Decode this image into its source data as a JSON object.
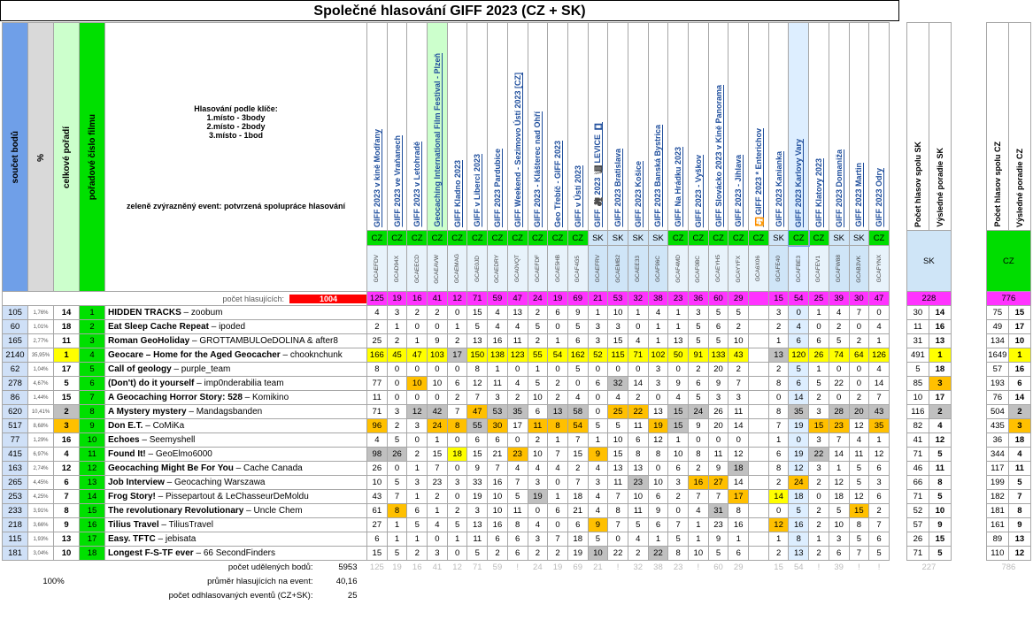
{
  "title": "Společné hlasování GIFF 2023 (CZ + SK)",
  "left_headers": {
    "sum": "součet bodů",
    "pct": "%",
    "overall": "celkové pořadí",
    "order": "pořadové číslo filmu"
  },
  "legend": {
    "line1": "Hlasování podle klíče:",
    "line2": "1.místo - 3body",
    "line3": "2.místo - 2body",
    "line4": "3.místo - 1bod",
    "note": "zeleně zvýrazněný event: potvrzená spolupráce hlasování"
  },
  "voters_label": "počet hlasujících:",
  "voters_total": "1004",
  "events": [
    {
      "name": "GIFF 2023 v kině Modřany",
      "cc": "CZ",
      "code": "GCAEFDV",
      "voters": "125"
    },
    {
      "name": "GIFF 2023 ve Vraňanech",
      "cc": "CZ",
      "code": "GCAD94X",
      "voters": "19"
    },
    {
      "name": "GIFF 2023 v Letohradě",
      "cc": "CZ",
      "code": "GCAEECD",
      "voters": "16"
    },
    {
      "name": "Geocaching International Film Festival - Plzeň",
      "cc": "CZ",
      "code": "GCAEAVW",
      "voters": "41"
    },
    {
      "name": "GIFF Kladno 2023",
      "cc": "CZ",
      "code": "GCAEMAG",
      "voters": "12"
    },
    {
      "name": "GIFF v Liberci 2023",
      "cc": "CZ",
      "code": "GCAE0JD",
      "voters": "71"
    },
    {
      "name": "GIFF 2023 Pardubice",
      "cc": "CZ",
      "code": "GCAEDRY",
      "voters": "59"
    },
    {
      "name": "GIFF Weekend - Sezimovo Ústí 2023 [CZ]",
      "cc": "CZ",
      "code": "GCA0VQT",
      "voters": "47"
    },
    {
      "name": "GIFF 2023 - Klášterec nad Ohří",
      "cc": "CZ",
      "code": "GCAEFDF",
      "voters": "24"
    },
    {
      "name": "Geo Třebíč - GIFF 2023",
      "cc": "CZ",
      "code": "GCAE5HB",
      "voters": "19"
    },
    {
      "name": "GIFF v Ústí 2023",
      "cc": "CZ",
      "code": "GCAF4G5",
      "voters": "69"
    },
    {
      "name": "GIFF 🎥 2023 🎬 LEVICE 🎞",
      "cc": "SK",
      "code": "GCAEFRV",
      "voters": "21"
    },
    {
      "name": "GIFF 2023 Bratislava",
      "cc": "SK",
      "code": "GCAEMB2",
      "voters": "53"
    },
    {
      "name": "GIFF 2023 Košice",
      "cc": "SK",
      "code": "GCAEE33",
      "voters": "32"
    },
    {
      "name": "GIFF 2023 Banská Bystrica",
      "cc": "SK",
      "code": "GCAF96C",
      "voters": "38"
    },
    {
      "name": "GIFF Na Hrádku 2023",
      "cc": "CZ",
      "code": "GCAF4MD",
      "voters": "23"
    },
    {
      "name": "GIFF 2023 - Vyškov",
      "cc": "CZ",
      "code": "GCAF0BC",
      "voters": "36"
    },
    {
      "name": "GIFF Slovácko 2023 v Kině Panorama",
      "cc": "CZ",
      "code": "GCAEYH5",
      "voters": "60"
    },
    {
      "name": "GIFF 2023 - Jihlava",
      "cc": "CZ",
      "code": "GCAYYFX",
      "voters": "29"
    },
    {
      "name": "🎦 GIFF 2023 * Enterichov",
      "cc": "CZ",
      "code": "GCA6X06",
      "voters": ""
    },
    {
      "name": "GIFF 2023 Kanianka",
      "cc": "SK",
      "code": "GCAFE40",
      "voters": "15"
    },
    {
      "name": "GIFF 2023 Karlovy Vary",
      "cc": "CZ",
      "code": "GCAFBE3",
      "voters": "54"
    },
    {
      "name": "GIFF Klatovy 2023",
      "cc": "CZ",
      "code": "GCAFEV1",
      "voters": "25"
    },
    {
      "name": "GIFF 2023 Domaniža",
      "cc": "SK",
      "code": "GCAFW88",
      "voters": "39"
    },
    {
      "name": "GIFF 2023 Martin",
      "cc": "SK",
      "code": "GCAB3VK",
      "voters": "30"
    },
    {
      "name": "GIFF 2023 Odry",
      "cc": "CZ",
      "code": "GCAFYNX",
      "voters": "47"
    }
  ],
  "sk_block": {
    "h1": "Počet hlasov spolu SK",
    "h2": "Výsledné poradie SK",
    "label": "SK",
    "voters": "228"
  },
  "cz_block": {
    "h1": "Počet hlasov spolu CZ",
    "h2": "Výsledné poradie CZ",
    "label": "CZ",
    "voters": "776"
  },
  "films": [
    {
      "sum": "105",
      "pct": "1,76%",
      "rank": "14",
      "order": "1",
      "title": "HIDDEN TRACKS",
      "author": "zoobum",
      "votes": [
        "4",
        "3",
        "2",
        "2",
        "0",
        "15",
        "4",
        "13",
        "2",
        "6",
        "9",
        "1",
        "10",
        "1",
        "4",
        "1",
        "3",
        "5",
        "5",
        "",
        "3",
        "0",
        "1",
        "4",
        "7",
        "0"
      ],
      "sk": "30",
      "skr": "14",
      "cz": "75",
      "czr": "15"
    },
    {
      "sum": "60",
      "pct": "1,01%",
      "rank": "18",
      "order": "2",
      "title": "Eat Sleep Cache Repeat",
      "author": "ipoded",
      "votes": [
        "2",
        "1",
        "0",
        "0",
        "1",
        "5",
        "4",
        "4",
        "5",
        "0",
        "5",
        "3",
        "3",
        "0",
        "1",
        "1",
        "5",
        "6",
        "2",
        "",
        "2",
        "4",
        "0",
        "2",
        "0",
        "4"
      ],
      "sk": "11",
      "skr": "16",
      "cz": "49",
      "czr": "17"
    },
    {
      "sum": "165",
      "pct": "2,77%",
      "rank": "11",
      "order": "3",
      "title": "Roman GeoHoliday",
      "author": "GROTTAMBULOeDOLINA & after8",
      "votes": [
        "25",
        "2",
        "1",
        "9",
        "2",
        "13",
        "16",
        "11",
        "2",
        "1",
        "6",
        "3",
        "15",
        "4",
        "1",
        "13",
        "5",
        "5",
        "10",
        "",
        "1",
        "6",
        "6",
        "5",
        "2",
        "1"
      ],
      "sk": "31",
      "skr": "13",
      "cz": "134",
      "czr": "10"
    },
    {
      "sum": "2140",
      "pct": "35,95%",
      "rank": "1",
      "order": "4",
      "title": "Geocare – Home for the Aged Geocacher",
      "author": "chooknchunk",
      "votes": [
        "166",
        "45",
        "47",
        "103",
        "17",
        "150",
        "138",
        "123",
        "55",
        "54",
        "162",
        "52",
        "115",
        "71",
        "102",
        "50",
        "91",
        "133",
        "43",
        "",
        "13",
        "120",
        "26",
        "74",
        "64",
        "126"
      ],
      "sk": "491",
      "skr": "1",
      "cz": "1649",
      "czr": "1"
    },
    {
      "sum": "62",
      "pct": "1,04%",
      "rank": "17",
      "order": "5",
      "title": "Call of geology",
      "author": "purple_team",
      "votes": [
        "8",
        "0",
        "0",
        "0",
        "0",
        "8",
        "1",
        "0",
        "1",
        "0",
        "5",
        "0",
        "0",
        "0",
        "3",
        "0",
        "2",
        "20",
        "2",
        "",
        "2",
        "5",
        "1",
        "0",
        "0",
        "4"
      ],
      "sk": "5",
      "skr": "18",
      "cz": "57",
      "czr": "16"
    },
    {
      "sum": "278",
      "pct": "4,67%",
      "rank": "5",
      "order": "6",
      "title": "(Don't) do it yourself",
      "author": "imp0nderabilia team",
      "votes": [
        "77",
        "0",
        "10",
        "10",
        "6",
        "12",
        "11",
        "4",
        "5",
        "2",
        "0",
        "6",
        "32",
        "14",
        "3",
        "9",
        "6",
        "9",
        "7",
        "",
        "8",
        "6",
        "5",
        "22",
        "0",
        "14"
      ],
      "sk": "85",
      "skr": "3",
      "cz": "193",
      "czr": "6"
    },
    {
      "sum": "86",
      "pct": "1,44%",
      "rank": "15",
      "order": "7",
      "title": "A Geocaching Horror Story: 528",
      "author": "Komikino",
      "votes": [
        "11",
        "0",
        "0",
        "0",
        "2",
        "7",
        "3",
        "2",
        "10",
        "2",
        "4",
        "0",
        "4",
        "2",
        "0",
        "4",
        "5",
        "3",
        "3",
        "",
        "0",
        "14",
        "2",
        "0",
        "2",
        "7"
      ],
      "sk": "10",
      "skr": "17",
      "cz": "76",
      "czr": "14"
    },
    {
      "sum": "620",
      "pct": "10,41%",
      "rank": "2",
      "order": "8",
      "title": "A Mystery mystery",
      "author": "Mandagsbanden",
      "votes": [
        "71",
        "3",
        "12",
        "42",
        "7",
        "47",
        "53",
        "35",
        "6",
        "13",
        "58",
        "0",
        "25",
        "22",
        "13",
        "15",
        "24",
        "26",
        "11",
        "",
        "8",
        "35",
        "3",
        "28",
        "20",
        "43"
      ],
      "sk": "116",
      "skr": "2",
      "cz": "504",
      "czr": "2"
    },
    {
      "sum": "517",
      "pct": "8,68%",
      "rank": "3",
      "order": "9",
      "title": "Don E.T.",
      "author": "CoMiKa",
      "votes": [
        "96",
        "2",
        "3",
        "24",
        "8",
        "55",
        "30",
        "17",
        "11",
        "8",
        "54",
        "5",
        "5",
        "11",
        "19",
        "15",
        "9",
        "20",
        "14",
        "",
        "7",
        "19",
        "15",
        "23",
        "12",
        "35"
      ],
      "sk": "82",
      "skr": "4",
      "cz": "435",
      "czr": "3"
    },
    {
      "sum": "77",
      "pct": "1,29%",
      "rank": "16",
      "order": "10",
      "title": "Echoes",
      "author": "Seemyshell",
      "votes": [
        "4",
        "5",
        "0",
        "1",
        "0",
        "6",
        "6",
        "0",
        "2",
        "1",
        "7",
        "1",
        "10",
        "6",
        "12",
        "1",
        "0",
        "0",
        "0",
        "",
        "1",
        "0",
        "3",
        "7",
        "4",
        "1"
      ],
      "sk": "41",
      "skr": "12",
      "cz": "36",
      "czr": "18"
    },
    {
      "sum": "415",
      "pct": "6,97%",
      "rank": "4",
      "order": "11",
      "title": "Found It!",
      "author": "GeoElmo6000",
      "votes": [
        "98",
        "26",
        "2",
        "15",
        "18",
        "15",
        "21",
        "23",
        "10",
        "7",
        "15",
        "9",
        "15",
        "8",
        "8",
        "10",
        "8",
        "11",
        "12",
        "",
        "6",
        "19",
        "22",
        "14",
        "11",
        "12"
      ],
      "sk": "71",
      "skr": "5",
      "cz": "344",
      "czr": "4"
    },
    {
      "sum": "163",
      "pct": "2,74%",
      "rank": "12",
      "order": "12",
      "title": "Geocaching Might Be For You",
      "author": "Cache Canada",
      "votes": [
        "26",
        "0",
        "1",
        "7",
        "0",
        "9",
        "7",
        "4",
        "4",
        "4",
        "2",
        "4",
        "13",
        "13",
        "0",
        "6",
        "2",
        "9",
        "18",
        "",
        "8",
        "12",
        "3",
        "1",
        "5",
        "6"
      ],
      "sk": "46",
      "skr": "11",
      "cz": "117",
      "czr": "11"
    },
    {
      "sum": "265",
      "pct": "4,45%",
      "rank": "6",
      "order": "13",
      "title": "Job Interview",
      "author": "Geocaching Warszawa",
      "votes": [
        "10",
        "5",
        "3",
        "23",
        "3",
        "33",
        "16",
        "7",
        "3",
        "0",
        "7",
        "3",
        "11",
        "23",
        "10",
        "3",
        "16",
        "27",
        "14",
        "",
        "2",
        "24",
        "2",
        "12",
        "5",
        "3"
      ],
      "sk": "66",
      "skr": "8",
      "cz": "199",
      "czr": "5"
    },
    {
      "sum": "253",
      "pct": "4,25%",
      "rank": "7",
      "order": "14",
      "title": "Frog Story!",
      "author": "Pissepartout & LeChasseurDeMoldu",
      "votes": [
        "43",
        "7",
        "1",
        "2",
        "0",
        "19",
        "10",
        "5",
        "19",
        "1",
        "18",
        "4",
        "7",
        "10",
        "6",
        "2",
        "7",
        "7",
        "17",
        "",
        "14",
        "18",
        "0",
        "18",
        "12",
        "6"
      ],
      "sk": "71",
      "skr": "5",
      "cz": "182",
      "czr": "7"
    },
    {
      "sum": "233",
      "pct": "3,91%",
      "rank": "8",
      "order": "15",
      "title": "The revolutionary Revolutionary",
      "author": "Uncle Chem",
      "votes": [
        "61",
        "8",
        "6",
        "1",
        "2",
        "3",
        "10",
        "11",
        "0",
        "6",
        "21",
        "4",
        "8",
        "11",
        "9",
        "0",
        "4",
        "31",
        "8",
        "",
        "0",
        "5",
        "2",
        "5",
        "15",
        "2"
      ],
      "sk": "52",
      "skr": "10",
      "cz": "181",
      "czr": "8"
    },
    {
      "sum": "218",
      "pct": "3,66%",
      "rank": "9",
      "order": "16",
      "title": "Tilius Travel",
      "author": "TiliusTravel",
      "votes": [
        "27",
        "1",
        "5",
        "4",
        "5",
        "13",
        "16",
        "8",
        "4",
        "0",
        "6",
        "9",
        "7",
        "5",
        "6",
        "7",
        "1",
        "23",
        "16",
        "",
        "12",
        "16",
        "2",
        "10",
        "8",
        "7"
      ],
      "sk": "57",
      "skr": "9",
      "cz": "161",
      "czr": "9"
    },
    {
      "sum": "115",
      "pct": "1,93%",
      "rank": "13",
      "order": "17",
      "title": "Easy. TFTC",
      "author": "jebisata",
      "votes": [
        "6",
        "1",
        "1",
        "0",
        "1",
        "11",
        "6",
        "6",
        "3",
        "7",
        "18",
        "5",
        "0",
        "4",
        "1",
        "5",
        "1",
        "9",
        "1",
        "",
        "1",
        "8",
        "1",
        "3",
        "5",
        "6"
      ],
      "sk": "26",
      "skr": "15",
      "cz": "89",
      "czr": "13"
    },
    {
      "sum": "181",
      "pct": "3,04%",
      "rank": "10",
      "order": "18",
      "title": "Longest F-S-TF ever",
      "author": "66 SecondFinders",
      "votes": [
        "15",
        "5",
        "2",
        "3",
        "0",
        "5",
        "2",
        "6",
        "2",
        "2",
        "19",
        "10",
        "22",
        "2",
        "22",
        "8",
        "10",
        "5",
        "6",
        "",
        "2",
        "13",
        "2",
        "6",
        "7",
        "5"
      ],
      "sk": "71",
      "skr": "5",
      "cz": "110",
      "czr": "12"
    }
  ],
  "footer": {
    "pct_total": "100%",
    "points_label": "počet udělených bodů:",
    "points_value": "5953",
    "avg_label": "průměr hlasujících na event:",
    "avg_value": "40,16",
    "events_label": "počet odhlasovaných eventů (CZ+SK):",
    "events_value": "25",
    "faded_voters": [
      "125",
      "19",
      "16",
      "41",
      "12",
      "71",
      "59",
      "!",
      "24",
      "19",
      "69",
      "21",
      "!",
      "32",
      "38",
      "23",
      "!",
      "60",
      "29",
      "",
      "15",
      "54",
      "!",
      "39",
      "!",
      "!"
    ],
    "sk_faded": "227",
    "cz_faded": "786"
  }
}
